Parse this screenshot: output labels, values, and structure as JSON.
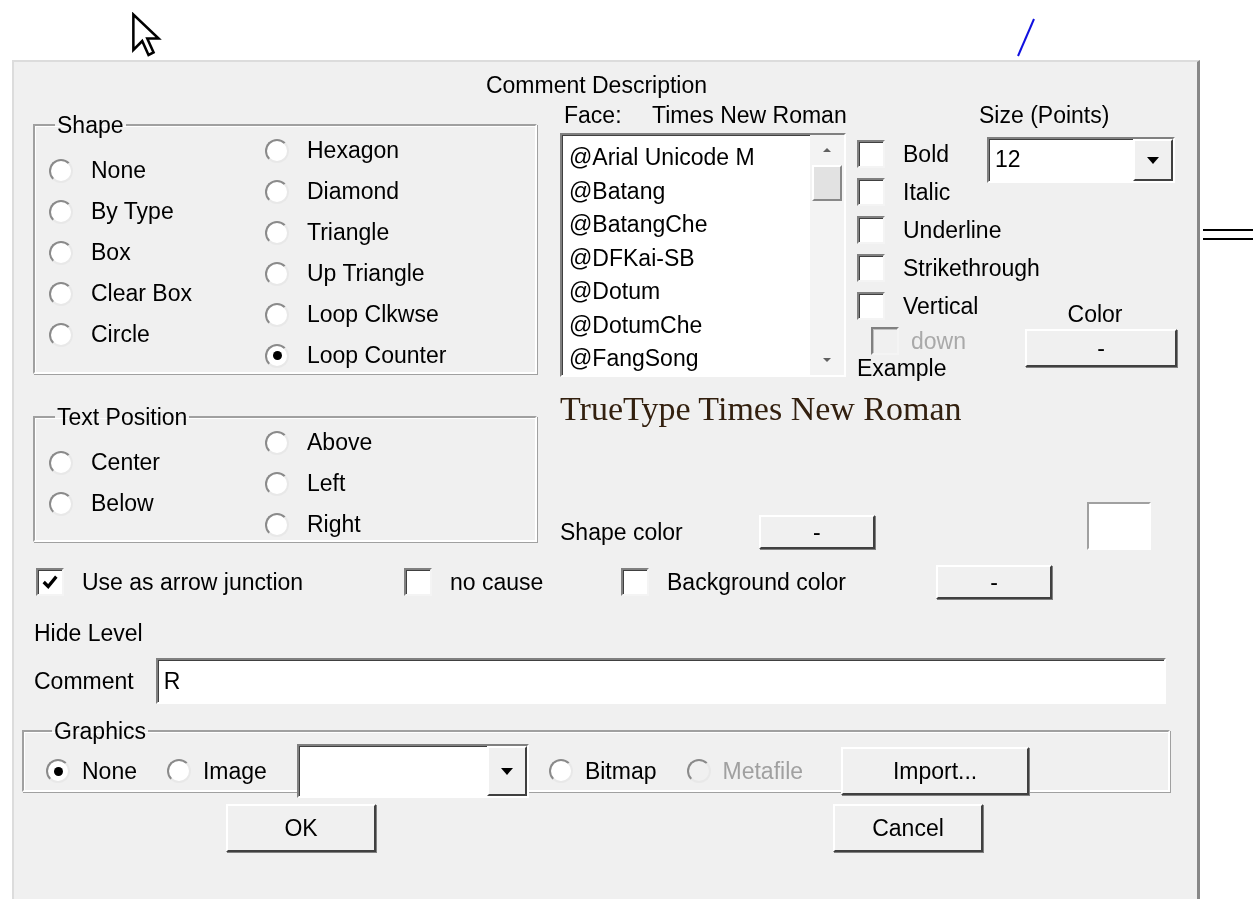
{
  "dialog": {
    "title": "Comment Description"
  },
  "shape": {
    "label": "Shape",
    "columns": [
      [
        {
          "label": "None",
          "selected": false
        },
        {
          "label": "By Type",
          "selected": false
        },
        {
          "label": "Box",
          "selected": false
        },
        {
          "label": "Clear Box",
          "selected": false
        },
        {
          "label": "Circle",
          "selected": false
        }
      ],
      [
        {
          "label": "Hexagon",
          "selected": false
        },
        {
          "label": "Diamond",
          "selected": false
        },
        {
          "label": "Triangle",
          "selected": false
        },
        {
          "label": "Up Triangle",
          "selected": false
        },
        {
          "label": "Loop Clkwse",
          "selected": false
        },
        {
          "label": "Loop Counter",
          "selected": true
        }
      ]
    ]
  },
  "text_position": {
    "label": "Text Position",
    "columns": [
      [
        {
          "label": "Center",
          "selected": false
        },
        {
          "label": "Below",
          "selected": false
        }
      ],
      [
        {
          "label": "Above",
          "selected": false
        },
        {
          "label": "Left",
          "selected": false
        },
        {
          "label": "Right",
          "selected": false
        }
      ]
    ]
  },
  "font": {
    "face_label": "Face:",
    "face": "Times New Roman",
    "faces": [
      "@Arial Unicode M",
      "@Batang",
      "@BatangChe",
      "@DFKai-SB",
      "@Dotum",
      "@DotumChe",
      "@FangSong"
    ],
    "size_label": "Size (Points)",
    "size": "12",
    "styles": [
      {
        "label": "Bold",
        "checked": false,
        "disabled": false
      },
      {
        "label": "Italic",
        "checked": false,
        "disabled": false
      },
      {
        "label": "Underline",
        "checked": false,
        "disabled": false
      },
      {
        "label": "Strikethrough",
        "checked": false,
        "disabled": false
      },
      {
        "label": "Vertical",
        "checked": false,
        "disabled": false
      }
    ],
    "down": {
      "label": "down",
      "checked": false,
      "disabled": true
    },
    "color_label": "Color",
    "color_button": "-",
    "example_label": "Example",
    "example_text": "TrueType Times New Roman"
  },
  "shape_color": {
    "label": "Shape color",
    "button": "-"
  },
  "options": [
    {
      "label": "Use as arrow junction",
      "checked": true
    },
    {
      "label": "no cause",
      "checked": false
    },
    {
      "label": "Background color",
      "checked": false
    }
  ],
  "background_color_button": "-",
  "hide_level": "Hide Level",
  "comment": {
    "label": "Comment",
    "value": "R"
  },
  "graphics": {
    "label": "Graphics",
    "options": [
      {
        "label": "None",
        "selected": true,
        "disabled": false
      },
      {
        "label": "Image",
        "selected": false,
        "disabled": false
      }
    ],
    "formats": [
      {
        "label": "Bitmap",
        "selected": false,
        "disabled": false
      },
      {
        "label": "Metafile",
        "selected": false,
        "disabled": true
      }
    ],
    "import_button": "Import..."
  },
  "buttons": [
    {
      "label": "OK"
    },
    {
      "label": "Cancel"
    }
  ]
}
